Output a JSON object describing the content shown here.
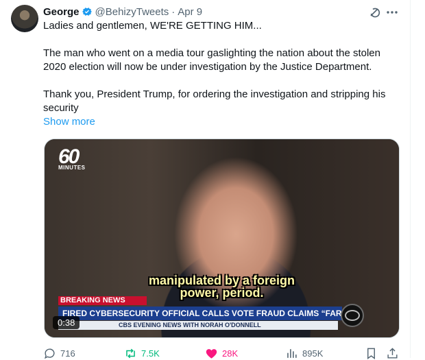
{
  "tweet": {
    "author_name": "George",
    "handle": "@BehizyTweets",
    "separator": "·",
    "date": "Apr 9",
    "paragraphs": [
      "Ladies and gentlemen, WE'RE GETTING HIM...",
      "The man who went on a media tour gaslighting the nation about the stolen 2020 election will now be under investigation by the Justice Department.",
      "Thank you, President Trump, for ordering the investigation and stripping his security"
    ],
    "show_more": "Show more"
  },
  "video": {
    "logo_number": "60",
    "logo_word": "MINUTES",
    "caption_line1": "manipulated by a foreign",
    "caption_line2": "power, period.",
    "breaking_label": "BREAKING NEWS",
    "chyron": "FIRED CYBERSECURITY OFFICIAL CALLS VOTE FRAUD CLAIMS “FARCICAL”",
    "network_bar": "CBS EVENING NEWS WITH NORAH O'DONNELL",
    "duration": "0:38"
  },
  "actions": {
    "replies": "716",
    "reposts": "7.5K",
    "likes": "28K",
    "views": "895K"
  },
  "colors": {
    "accent": "#1d9bf0",
    "repost": "#00ba7c",
    "like": "#f91880",
    "muted": "#536471"
  }
}
